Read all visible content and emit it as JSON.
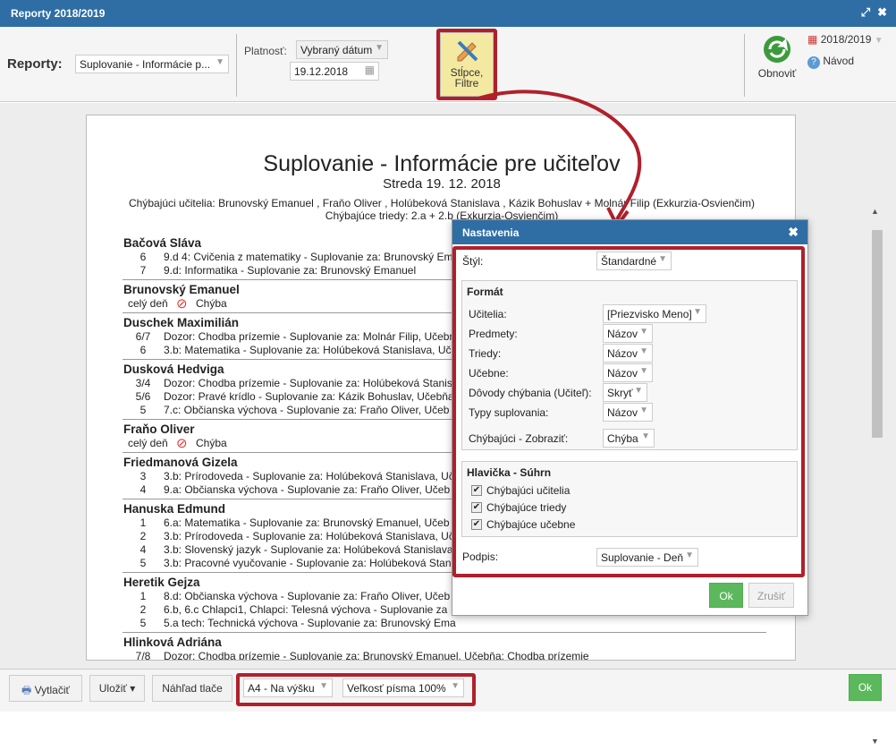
{
  "window": {
    "title": "Reporty 2018/2019"
  },
  "toolbar": {
    "reports_label": "Reporty:",
    "report_value": "Suplovanie - Informácie p...",
    "validity_label": "Platnosť:",
    "validity_value": "Vybraný dátum",
    "date_value": "19.12.2018",
    "filters_btn_line1": "Stĺpce,",
    "filters_btn_line2": "Filtre",
    "refresh_label": "Obnoviť",
    "year_label": "2018/2019",
    "help_label": "Návod"
  },
  "report": {
    "title": "Suplovanie - Informácie pre učiteľov",
    "subtitle": "Streda 19. 12. 2018",
    "missing_teachers": "Chýbajúci učitelia: Brunovský Emanuel , Fraňo Oliver , Holúbeková Stanislava , Kázik Bohuslav + Molnár Filip (Exkurzia-Osvienčim)",
    "missing_classes": "Chýbajúce triedy: 2.a + 2.b (Exkurzia-Osvienčim)",
    "entries": [
      {
        "name": "Bačová Sláva",
        "lines": [
          {
            "h": "6",
            "t": "9.d 4: Cvičenia z matematiky - Suplovanie za: Brunovský Em"
          },
          {
            "h": "7",
            "t": "9.d: Informatika - Suplovanie za: Brunovský Emanuel"
          }
        ]
      },
      {
        "name": "Brunovský Emanuel",
        "absence": {
          "day": "celý deň",
          "reason": "Chýba"
        }
      },
      {
        "name": "Duschek Maximilián",
        "lines": [
          {
            "h": "6/7",
            "t": "Dozor: Chodba prízemie - Suplovanie za: Molnár Filip, Učebn"
          },
          {
            "h": "6",
            "t": "3.b: Matematika - Suplovanie za: Holúbeková Stanislava, Uč"
          }
        ]
      },
      {
        "name": "Dusková Hedviga",
        "lines": [
          {
            "h": "3/4",
            "t": "Dozor: Chodba prízemie - Suplovanie za: Holúbeková Stanis"
          },
          {
            "h": "5/6",
            "t": "Dozor: Pravé krídlo - Suplovanie za: Kázik Bohuslav, Učebňa"
          },
          {
            "h": "5",
            "t": "7.c: Občianska výchova - Suplovanie za: Fraňo Oliver, Učeb"
          }
        ]
      },
      {
        "name": "Fraňo Oliver",
        "absence": {
          "day": "celý deň",
          "reason": "Chýba"
        }
      },
      {
        "name": "Friedmanová Gizela",
        "lines": [
          {
            "h": "3",
            "t": "3.b: Prírodoveda - Suplovanie za: Holúbeková Stanislava, Uč"
          },
          {
            "h": "4",
            "t": "9.a: Občianska výchova - Suplovanie za: Fraňo Oliver, Učeb"
          }
        ]
      },
      {
        "name": "Hanuska Edmund",
        "lines": [
          {
            "h": "1",
            "t": "6.a: Matematika - Suplovanie za: Brunovský Emanuel, Učeb"
          },
          {
            "h": "2",
            "t": "3.b: Prírodoveda - Suplovanie za: Holúbeková Stanislava, Uč"
          },
          {
            "h": "4",
            "t": "3.b: Slovenský jazyk - Suplovanie za: Holúbeková Stanislava"
          },
          {
            "h": "5",
            "t": "3.b: Pracovné vyučovanie - Suplovanie za: Holúbeková Stan"
          }
        ]
      },
      {
        "name": "Heretik Gejza",
        "lines": [
          {
            "h": "1",
            "t": "8.d: Občianska výchova - Suplovanie za: Fraňo Oliver, Učeb"
          },
          {
            "h": "2",
            "t": "6.b, 6.c Chlapci1, Chlapci: Telesná výchova - Suplovanie za"
          },
          {
            "h": "5",
            "t": "5.a tech: Technická výchova - Suplovanie za: Brunovský Ema"
          }
        ]
      },
      {
        "name": "Hlinková Adriána",
        "lines": [
          {
            "h": "7/8",
            "t": "Dozor: Chodba prízemie - Suplovanie za: Brunovský Emanuel, Učebňa: Chodba prízemie"
          }
        ]
      }
    ]
  },
  "dialog": {
    "title": "Nastavenia",
    "style_label": "Štýl:",
    "style_value": "Štandardné",
    "format": {
      "heading": "Formát",
      "rows": [
        {
          "label": "Učitelia:",
          "value": "[Priezvisko Meno]"
        },
        {
          "label": "Predmety:",
          "value": "Názov"
        },
        {
          "label": "Triedy:",
          "value": "Názov"
        },
        {
          "label": "Učebne:",
          "value": "Názov"
        },
        {
          "label": "Dôvody chýbania (Učiteľ):",
          "value": "Skryť"
        },
        {
          "label": "Typy suplovania:",
          "value": "Názov"
        }
      ],
      "missing_label": "Chýbajúci - Zobraziť:",
      "missing_value": "Chýba"
    },
    "header": {
      "heading": "Hlavička - Súhrn",
      "checks": [
        "Chýbajúci učitelia",
        "Chýbajúce triedy",
        "Chýbajúce učebne"
      ]
    },
    "signature_label": "Podpis:",
    "signature_value": "Suplovanie - Deň",
    "ok": "Ok",
    "cancel": "Zrušiť"
  },
  "bottom": {
    "print": "Vytlačiť",
    "save": "Uložiť ▾",
    "preview": "Náhľad tlače",
    "paper": "A4 - Na výšku",
    "font": "Veľkosť písma 100%",
    "ok": "Ok"
  },
  "colors": {
    "accent": "#2f6ea5",
    "highlight": "#b0202b",
    "ok_green": "#5cb85c"
  }
}
